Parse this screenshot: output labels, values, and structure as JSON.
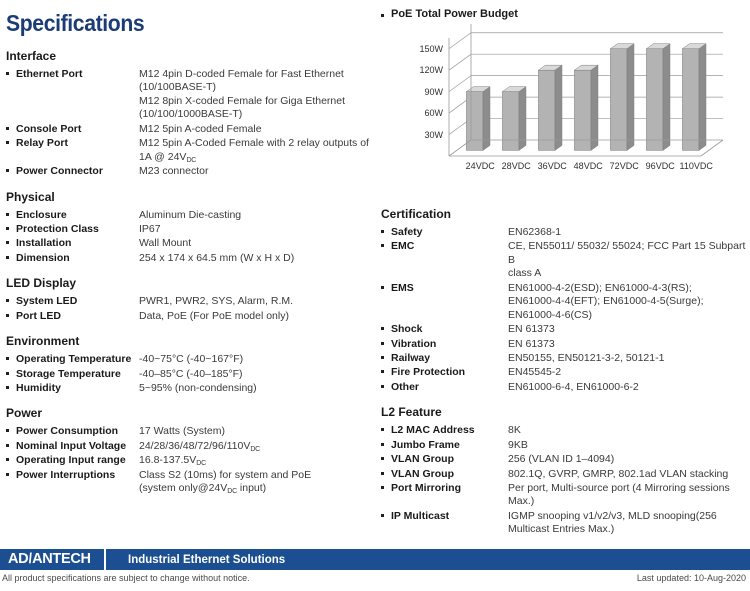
{
  "document": {
    "title": "Specifications"
  },
  "left_column": {
    "sections": [
      {
        "heading": "Interface",
        "rows": [
          {
            "label": "Ethernet Port",
            "value": "M12 4pin D-coded Female for Fast Ethernet\n(10/100BASE-T)\nM12 8pin X-coded Female for Giga Ethernet\n(10/100/1000BASE-T)"
          },
          {
            "label": "Console Port",
            "value": "M12 5pin A-coded Female"
          },
          {
            "label": "Relay Port",
            "value": "M12 5pin A-Coded Female with 2 relay outputs of\n1A @ 24VDC",
            "value_sub": "DC",
            "value_prefix": "M12 5pin A-Coded Female with 2 relay outputs of\n1A @ 24V"
          },
          {
            "label": "Power Connector",
            "value": "M23 connector"
          }
        ]
      },
      {
        "heading": "Physical",
        "rows": [
          {
            "label": "Enclosure",
            "value": "Aluminum Die-casting"
          },
          {
            "label": "Protection Class",
            "value": "IP67"
          },
          {
            "label": "Installation",
            "value": "Wall Mount"
          },
          {
            "label": "Dimension",
            "value": "254 x 174 x 64.5 mm (W x H x D)"
          }
        ]
      },
      {
        "heading": "LED Display",
        "rows": [
          {
            "label": "System LED",
            "value": "PWR1, PWR2, SYS, Alarm, R.M."
          },
          {
            "label": "Port LED",
            "value": "Data, PoE (For PoE model only)"
          }
        ]
      },
      {
        "heading": "Environment",
        "rows": [
          {
            "label": "Operating Temperature",
            "value": "-40~75°C (-40~167°F)"
          },
          {
            "label": "Storage Temperature",
            "value": "-40–85°C (-40–185°F)"
          },
          {
            "label": "Humidity",
            "value": "5~95% (non-condensing)"
          }
        ]
      },
      {
        "heading": "Power",
        "rows": [
          {
            "label": "Power Consumption",
            "value": "17 Watts (System)"
          },
          {
            "label": "Nominal Input Voltage",
            "value_prefix": "24/28/36/48/72/96/110V",
            "value_sub": "DC",
            "value": "24/28/36/48/72/96/110VDC"
          },
          {
            "label": "Operating Input range",
            "value_prefix": "16.8-137.5V",
            "value_sub": "DC",
            "value": "16.8-137.5VDC"
          },
          {
            "label": "Power Interruptions",
            "value_prefix": "Class S2 (10ms) for system and PoE\n(system only@24V",
            "value_sub": "DC",
            "value_suffix": " input)",
            "value": "Class S2 (10ms) for system and PoE\n(system only@24VDC input)"
          }
        ]
      }
    ]
  },
  "right_column": {
    "chart_title": "PoE Total Power Budget",
    "sections": [
      {
        "heading": "Certification",
        "rows": [
          {
            "label": "Safety",
            "value": "EN62368-1"
          },
          {
            "label": "EMC",
            "value": "CE, EN55011/ 55032/ 55024; FCC Part 15 Subpart B\nclass A"
          },
          {
            "label": "EMS",
            "value": "EN61000-4-2(ESD); EN61000-4-3(RS);\nEN61000-4-4(EFT); EN61000-4-5(Surge);\nEN61000-4-6(CS)"
          },
          {
            "label": "Shock",
            "value": "EN 61373"
          },
          {
            "label": "Vibration",
            "value": "EN 61373"
          },
          {
            "label": "Railway",
            "value": "EN50155, EN50121-3-2, 50121-1"
          },
          {
            "label": "Fire Protection",
            "value": "EN45545-2"
          },
          {
            "label": "Other",
            "value": "EN61000-6-4, EN61000-6-2"
          }
        ]
      },
      {
        "heading": "L2 Feature",
        "rows": [
          {
            "label": "L2 MAC Address",
            "value": "8K"
          },
          {
            "label": "Jumbo Frame",
            "value": "9KB"
          },
          {
            "label": "VLAN Group",
            "value": "256 (VLAN ID 1–4094)"
          },
          {
            "label": "VLAN Group",
            "value": "802.1Q, GVRP, GMRP, 802.1ad VLAN stacking"
          },
          {
            "label": "Port Mirroring",
            "value": "Per port, Multi-source port (4 Mirroring sessions\nMax.)"
          },
          {
            "label": "IP Multicast",
            "value": "IGMP snooping v1/v2/v3, MLD snooping(256\nMulticast Entries Max.)"
          }
        ]
      }
    ]
  },
  "chart_data": {
    "type": "bar",
    "title": "PoE Total Power Budget",
    "categories": [
      "24VDC",
      "28VDC",
      "36VDC",
      "48VDC",
      "72VDC",
      "96VDC",
      "110VDC"
    ],
    "values": [
      90,
      90,
      120,
      120,
      150,
      150,
      150
    ],
    "ytick_labels": [
      "30W",
      "60W",
      "90W",
      "120W",
      "150W"
    ],
    "ytick_values": [
      30,
      60,
      90,
      120,
      150
    ],
    "ylim": [
      0,
      165
    ],
    "xlabel": "",
    "ylabel": "",
    "grid": true,
    "legend": "none",
    "style": "3d-column",
    "bar_face_color": "#b3b3b3",
    "bar_top_color": "#d9d9d9",
    "bar_side_color": "#8c8c8c"
  },
  "footer": {
    "logo_part1": "AD",
    "logo_slash": "\\",
    "logo_part2": "ANTECH",
    "tagline": "Industrial Ethernet Solutions",
    "note": "All product specifications are subject to change without notice.",
    "last_updated": "Last updated: 10-Aug-2020"
  },
  "colors": {
    "title_blue": "#1b3c76",
    "footer_blue": "#1b4f91",
    "text_dark": "#231f20",
    "text_value": "#3a3a3a"
  }
}
